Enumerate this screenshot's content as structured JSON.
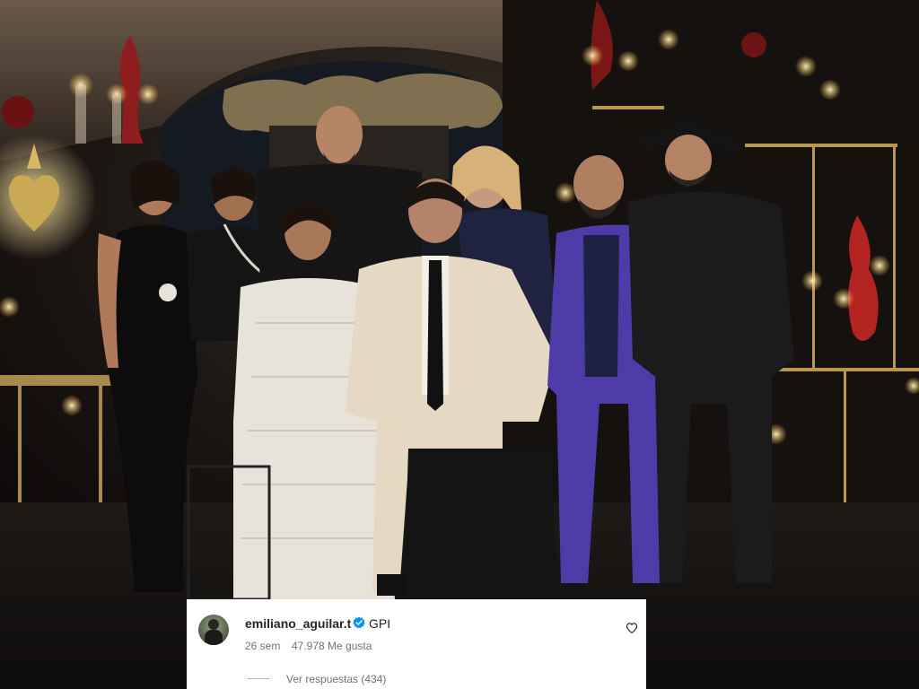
{
  "photo": {
    "description_icon": "wedding-group-photo"
  },
  "comment": {
    "username": "emiliano_aguilar.t",
    "verified_icon": "verified-badge-icon",
    "text": "GPI",
    "timestamp": "26 sem",
    "likes": "47.978 Me gusta",
    "like_icon": "heart-outline-icon",
    "replies_label": "Ver respuestas (434)"
  },
  "colors": {
    "verified_blue": "#0095f6",
    "username_text": "#262626",
    "meta_text": "#737373",
    "card_bg": "#ffffff"
  }
}
